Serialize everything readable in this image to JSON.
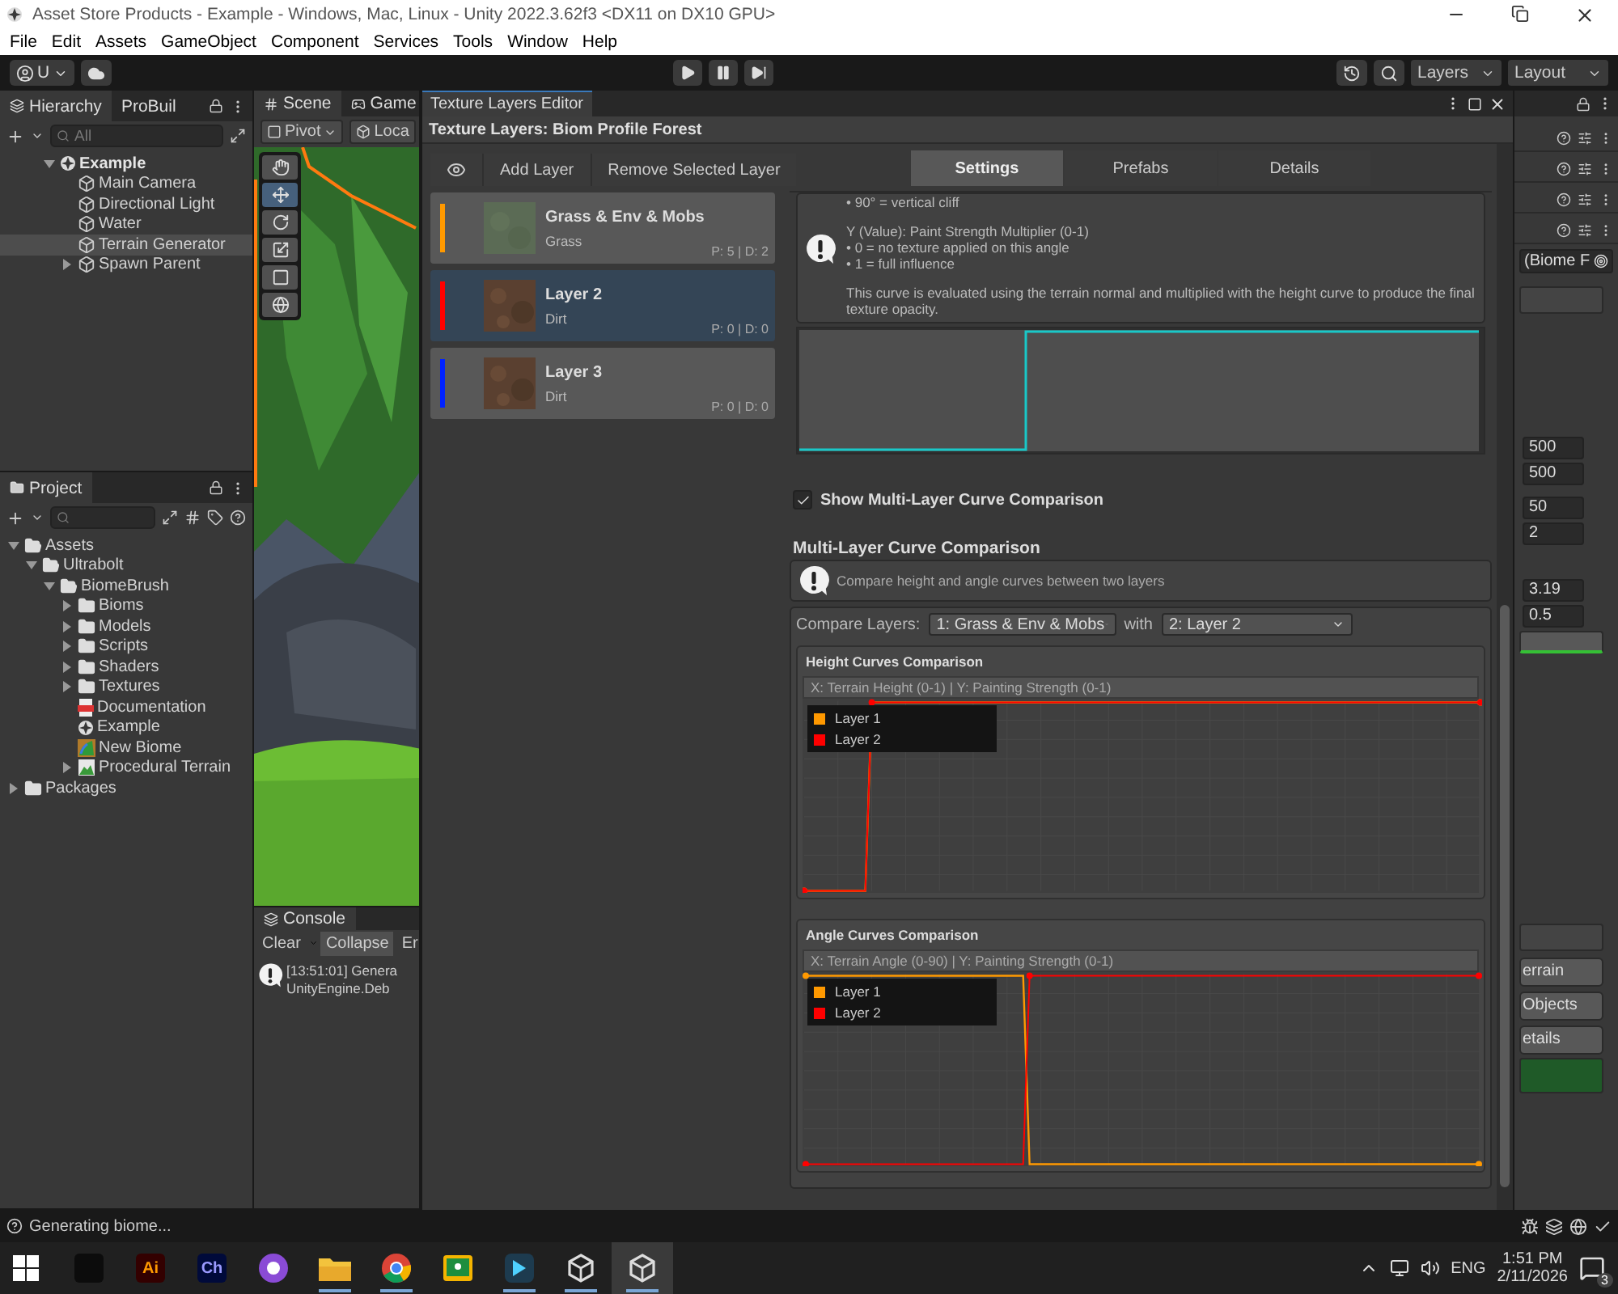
{
  "window": {
    "title": "Asset Store Products - Example - Windows, Mac, Linux - Unity 2022.3.62f3 <DX11 on DX10 GPU>"
  },
  "menu": [
    "File",
    "Edit",
    "Assets",
    "GameObject",
    "Component",
    "Services",
    "Tools",
    "Window",
    "Help"
  ],
  "toolbar": {
    "account": "U",
    "layers": "Layers",
    "layout": "Layout"
  },
  "hierarchy": {
    "tabs": [
      {
        "label": "Hierarchy",
        "selected": true
      },
      {
        "label": "ProBuil",
        "selected": false
      }
    ],
    "search": {
      "placeholder": "All"
    },
    "items": [
      {
        "label": "Example",
        "kind": "scene",
        "expanded": true,
        "selected": false,
        "children": [
          {
            "label": "Main Camera",
            "kind": "object",
            "selected": false
          },
          {
            "label": "Directional Light",
            "kind": "object",
            "selected": false
          },
          {
            "label": "Water",
            "kind": "object",
            "selected": false
          },
          {
            "label": "Terrain Generator",
            "kind": "object",
            "selected": true
          },
          {
            "label": "Spawn Parent",
            "kind": "object",
            "expanded": false,
            "selected": false
          }
        ]
      }
    ]
  },
  "project": {
    "tabs": [
      {
        "label": "Project",
        "selected": true
      }
    ],
    "items": [
      {
        "label": "Assets",
        "kind": "folder",
        "expanded": true,
        "selected": false,
        "children": [
          {
            "label": "Ultrabolt",
            "kind": "folder",
            "expanded": true,
            "selected": false,
            "children": [
              {
                "label": "BiomeBrush",
                "kind": "folder",
                "expanded": true,
                "selected": false,
                "children": [
                  {
                    "label": "Bioms",
                    "kind": "folder",
                    "expanded": false,
                    "selected": false
                  },
                  {
                    "label": "Models",
                    "kind": "folder",
                    "expanded": false,
                    "selected": false
                  },
                  {
                    "label": "Scripts",
                    "kind": "folder",
                    "expanded": false,
                    "selected": false
                  },
                  {
                    "label": "Shaders",
                    "kind": "folder",
                    "expanded": false,
                    "selected": false
                  },
                  {
                    "label": "Textures",
                    "kind": "folder",
                    "expanded": false,
                    "selected": false
                  },
                  {
                    "label": "Documentation",
                    "kind": "pdf",
                    "selected": false
                  },
                  {
                    "label": "Example",
                    "kind": "scene",
                    "selected": false
                  },
                  {
                    "label": "New Biome",
                    "kind": "biome",
                    "selected": false
                  },
                  {
                    "label": "Procedural Terrain",
                    "kind": "terrain",
                    "expanded": false,
                    "selected": false
                  }
                ]
              }
            ]
          }
        ]
      },
      {
        "label": "Packages",
        "kind": "folder",
        "expanded": false,
        "selected": false
      }
    ]
  },
  "scene": {
    "tabs": [
      {
        "label": "Scene",
        "selected": true
      },
      {
        "label": "Game",
        "selected": false
      }
    ],
    "pivot": "Pivot",
    "space": "Loca",
    "tools": [
      {
        "kind": "hand",
        "selected": false
      },
      {
        "kind": "move",
        "selected": true
      },
      {
        "kind": "rotate",
        "selected": false
      },
      {
        "kind": "scale",
        "selected": false
      },
      {
        "kind": "rect",
        "selected": false
      },
      {
        "kind": "transform",
        "selected": false
      }
    ]
  },
  "console": {
    "tab": "Console",
    "buttons": [
      "Clear",
      "Collapse",
      "Er"
    ],
    "log": [
      "[13:51:01] Genera",
      "UnityEngine.Deb"
    ]
  },
  "editor": {
    "tab": "Texture Layers Editor",
    "header": "Texture Layers: Biom Profile Forest",
    "buttons": [
      "Add Layer",
      "Remove Selected Layer"
    ],
    "layers": [
      {
        "name": "Grass & Env & Mobs",
        "texture": "Grass",
        "stats": "P: 5 | D: 2",
        "color": "#ff9900",
        "kind": "grass",
        "selected": false
      },
      {
        "name": "Layer 2",
        "texture": "Dirt",
        "stats": "P: 0 | D: 0",
        "color": "#ff0000",
        "kind": "dirt",
        "selected": true
      },
      {
        "name": "Layer 3",
        "texture": "Dirt",
        "stats": "P: 0 | D: 0",
        "color": "#0022ff",
        "kind": "dirt",
        "selected": false
      }
    ],
    "tabs": [
      {
        "label": "Settings",
        "selected": true
      },
      {
        "label": "Prefabs",
        "selected": false
      },
      {
        "label": "Details",
        "selected": false
      }
    ],
    "help": [
      [
        "• 90° = vertical cliff"
      ],
      [
        "Y (Value): Paint Strength Multiplier (0-1)",
        "• 0 = no texture applied on this angle",
        "• 1 = full influence"
      ],
      [
        "This curve is evaluated using the terrain normal and multiplied with the height curve to produce the final texture opacity."
      ]
    ],
    "show_comparison": {
      "label": "Show Multi-Layer Curve Comparison",
      "checked": true
    },
    "section_title": "Multi-Layer Curve Comparison",
    "info": "Compare height and angle curves between two layers",
    "compare": {
      "label": "Compare Layers:",
      "first": "1: Grass & Env & Mobs",
      "joiner": "with",
      "second": "2: Layer 2"
    },
    "graphs": [
      {
        "title": "Height Curves Comparison",
        "axes": "X: Terrain Height (0-1) | Y: Painting Strength (0-1)",
        "kind": "height",
        "legend": [
          {
            "label": "Layer 1",
            "color": "#ff9900"
          },
          {
            "label": "Layer 2",
            "color": "#ff0000"
          }
        ]
      },
      {
        "title": "Angle Curves Comparison",
        "axes": "X: Terrain Angle (0-90) | Y: Painting Strength (0-1)",
        "kind": "angle",
        "legend": [
          {
            "label": "Layer 1",
            "color": "#ff9900"
          },
          {
            "label": "Layer 2",
            "color": "#ff0000"
          }
        ]
      }
    ]
  },
  "inspector": {
    "object": "(Biome F",
    "values": [
      "500",
      "500",
      "50",
      "2",
      "3.19",
      "0.5"
    ],
    "buttons": [
      "errain",
      "Objects",
      "etails"
    ]
  },
  "status": "Generating biome...",
  "taskbar": {
    "apps": [
      {
        "kind": "terminal",
        "running": false,
        "selected": false
      },
      {
        "kind": "illustrator",
        "label": "Ai",
        "running": false,
        "selected": false
      },
      {
        "kind": "character",
        "label": "Ch",
        "running": false,
        "selected": false
      },
      {
        "kind": "github",
        "running": false,
        "selected": false
      },
      {
        "kind": "explorer",
        "running": true,
        "selected": false
      },
      {
        "kind": "chrome",
        "running": true,
        "selected": false
      },
      {
        "kind": "classroom",
        "running": false,
        "selected": false
      },
      {
        "kind": "editor",
        "running": true,
        "selected": false
      },
      {
        "kind": "unity",
        "running": true,
        "selected": false
      },
      {
        "kind": "unity",
        "running": true,
        "selected": true
      }
    ],
    "language": "ENG",
    "time": "1:51 PM",
    "date": "2/11/2026",
    "notifications": "3"
  }
}
